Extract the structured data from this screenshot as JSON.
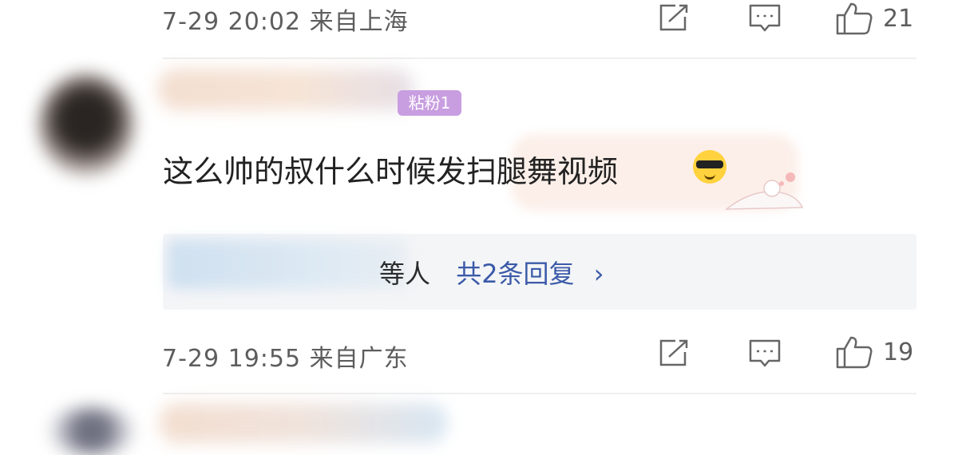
{
  "comment_top": {
    "meta": "7-29 20:02 来自上海",
    "like_count": "21"
  },
  "comment_main": {
    "badge": "粘粉1",
    "text": "这么帅的叔什么时候发扫腿舞视频",
    "emoji": "sunglasses-emoji",
    "reply_preview": {
      "partial_text": "等人",
      "link_text": "共2条回复",
      "chevron": "›"
    },
    "meta": "7-29 19:55 来自广东",
    "like_count": "19"
  },
  "colors": {
    "meta_text": "#5d5d5d",
    "link": "#3b5aa8",
    "badge": "#c89ee0",
    "reply_bg": "#f4f5f7"
  }
}
